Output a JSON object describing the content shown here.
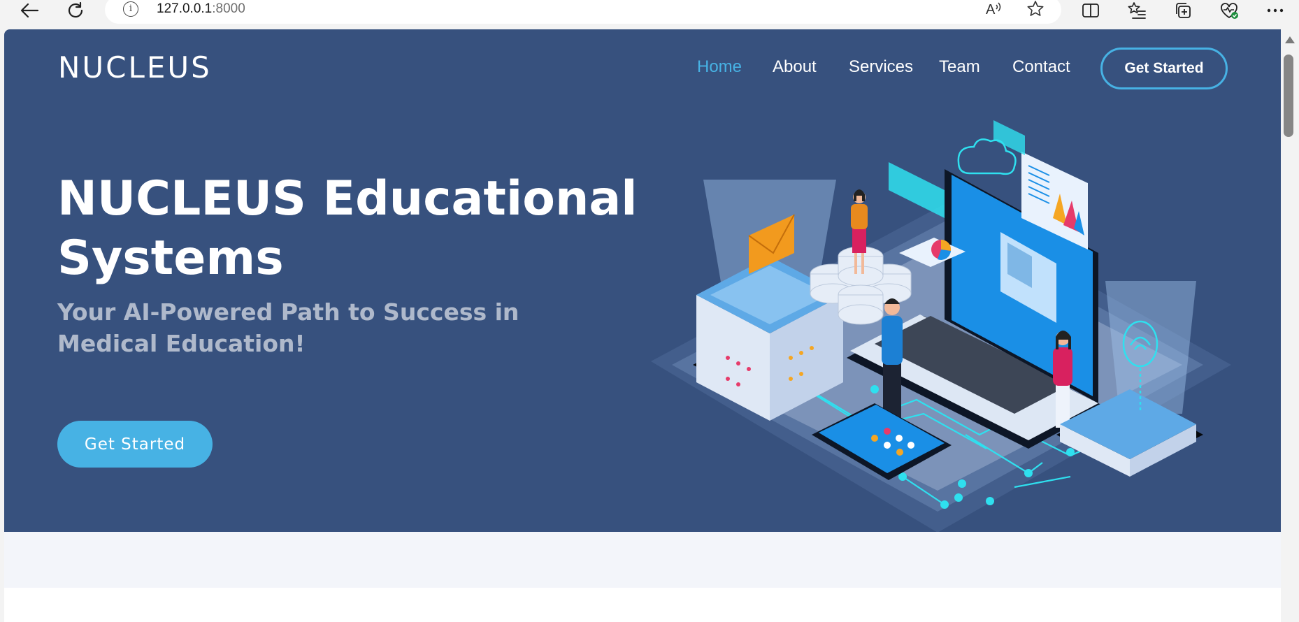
{
  "browser": {
    "url_host": "127.0.0.1",
    "url_port": ":8000",
    "icons": [
      "back-arrow-icon",
      "refresh-icon",
      "info-icon",
      "read-aloud-icon",
      "favorite-star-icon",
      "split-screen-icon",
      "favorites-list-icon",
      "collections-icon",
      "browser-essentials-icon",
      "more-menu-icon"
    ]
  },
  "site": {
    "logo": "NUCLEUS",
    "nav": [
      {
        "label": "Home",
        "active": true
      },
      {
        "label": "About"
      },
      {
        "label": "Services"
      },
      {
        "label": "Team"
      },
      {
        "label": "Contact"
      }
    ],
    "nav_cta": "Get Started"
  },
  "hero": {
    "title_line1": "NUCLEUS Educational",
    "title_line2": "Systems",
    "subtitle": "Your AI-Powered Path to Success in Medical Education!",
    "cta": "Get Started"
  },
  "colors": {
    "hero_bg": "#37517e",
    "accent": "#47b2e4",
    "section_bg": "#f3f5fa"
  }
}
